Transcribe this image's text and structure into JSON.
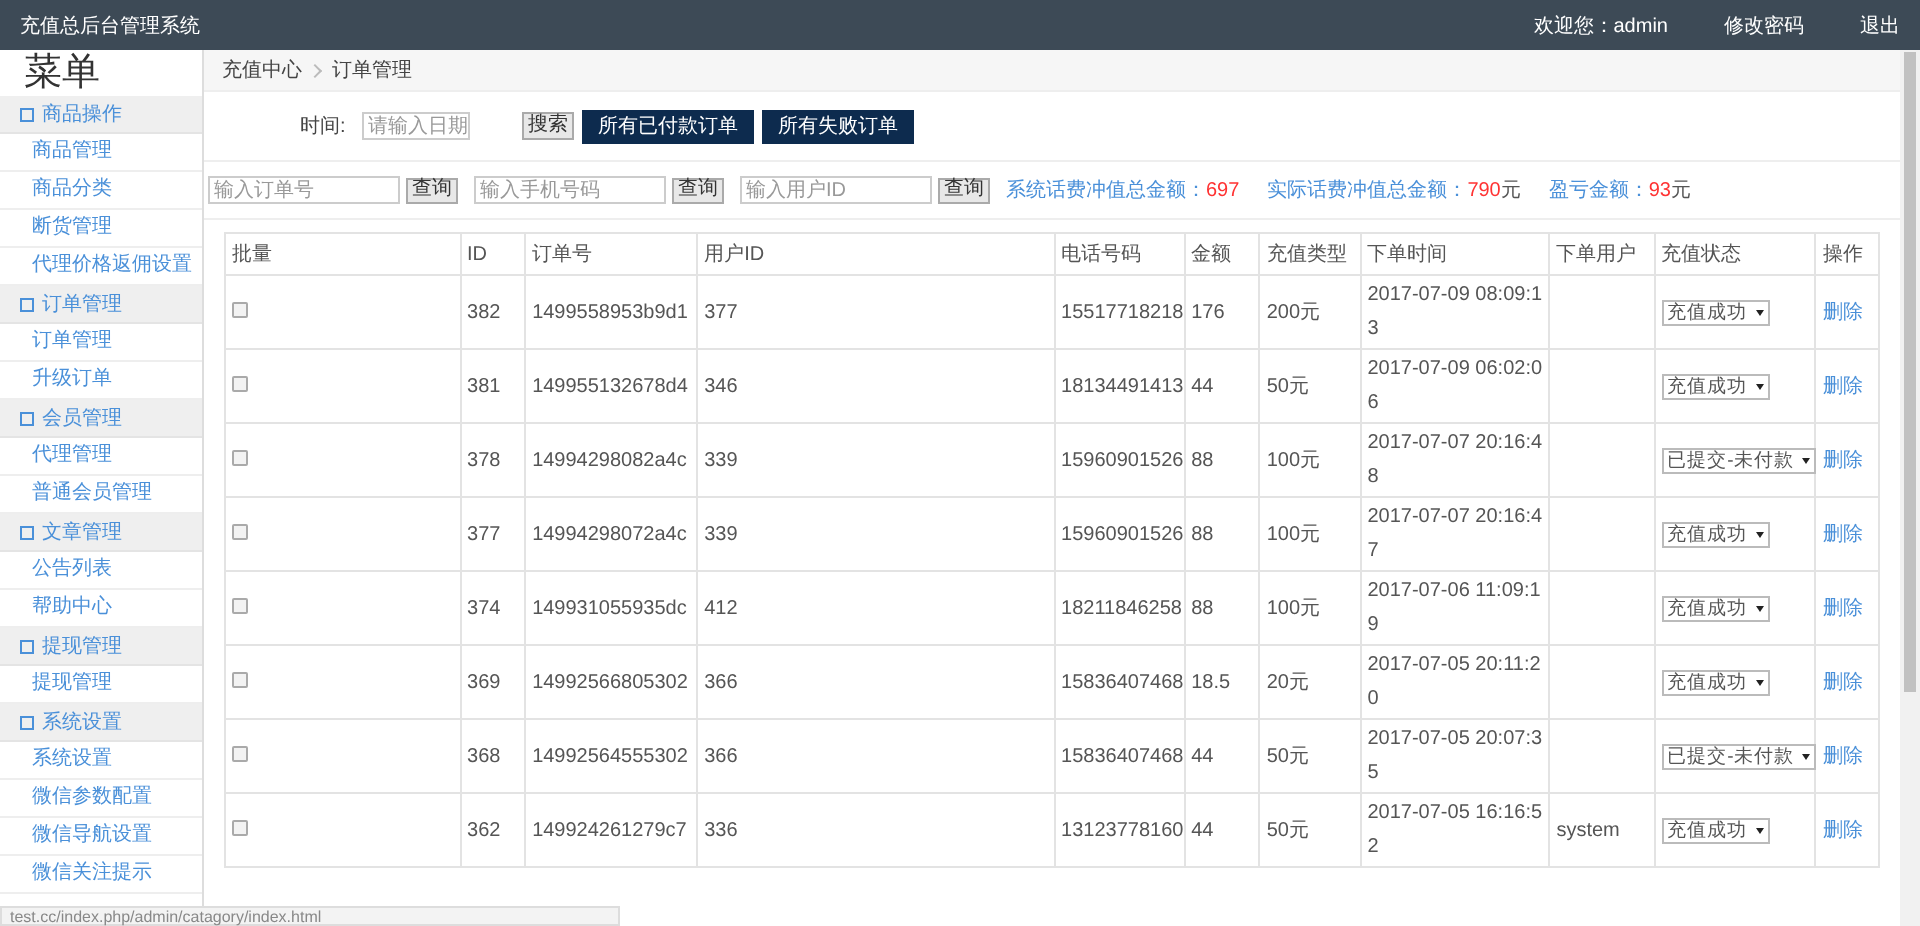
{
  "topbar": {
    "title": "充值总后台管理系统",
    "welcome": "欢迎您：admin",
    "links": [
      "修改密码",
      "退出"
    ]
  },
  "sidebar": {
    "heading": "菜单",
    "groups": [
      {
        "label": "商品操作",
        "items": [
          "商品管理",
          "商品分类",
          "断货管理",
          "代理价格返佣设置"
        ]
      },
      {
        "label": "订单管理",
        "items": [
          "订单管理",
          "升级订单"
        ]
      },
      {
        "label": "会员管理",
        "items": [
          "代理管理",
          "普通会员管理"
        ]
      },
      {
        "label": "文章管理",
        "items": [
          "公告列表",
          "帮助中心"
        ]
      },
      {
        "label": "提现管理",
        "items": [
          "提现管理"
        ]
      },
      {
        "label": "系统设置",
        "items": [
          "系统设置",
          "微信参数配置",
          "微信导航设置",
          "微信关注提示"
        ]
      }
    ]
  },
  "breadcrumb": [
    "充值中心",
    "订单管理"
  ],
  "date_filter": {
    "label": "时间:",
    "placeholder": "请输入日期",
    "button": "搜索"
  },
  "order_buttons": [
    "所有已付款订单",
    "所有失败订单"
  ],
  "queries": [
    {
      "placeholder": "输入订单号",
      "button": "查询"
    },
    {
      "placeholder": "输入手机号码",
      "button": "查询"
    },
    {
      "placeholder": "输入用户ID",
      "button": "查询"
    }
  ],
  "stats": [
    {
      "label": "系统话费冲值总金额：",
      "value": "697"
    },
    {
      "label": "实际话费冲值总金额：",
      "value": "790",
      "unit": "元"
    },
    {
      "label": "盈亏金额：",
      "value": "93",
      "unit": "元"
    }
  ],
  "table": {
    "columns": [
      "批量",
      "ID",
      "订单号",
      "用户ID",
      "电话号码",
      "金额",
      "充值类型",
      "下单时间",
      "下单用户",
      "充值状态",
      "操作"
    ],
    "rows": [
      {
        "checked": false,
        "id": "382",
        "order_no": "1499558953b9d1",
        "user_id": "377",
        "phone": "15517718218",
        "amount": "176",
        "type": "200元",
        "time": "2017-07-09 08:09:13",
        "status": "充值成功",
        "action": "删除"
      },
      {
        "checked": false,
        "id": "381",
        "order_no": "149955132678d4",
        "user_id": "346",
        "phone": "18134491413",
        "amount": "44",
        "type": "50元",
        "time": "2017-07-09 06:02:06",
        "status": "充值成功",
        "action": "删除"
      },
      {
        "checked": false,
        "id": "378",
        "order_no": "14994298082a4c",
        "user_id": "339",
        "phone": "15960901526",
        "amount": "88",
        "type": "100元",
        "time": "2017-07-07 20:16:48",
        "status": "已提交-未付款",
        "action": "删除"
      },
      {
        "checked": false,
        "id": "377",
        "order_no": "14994298072a4c",
        "user_id": "339",
        "phone": "15960901526",
        "amount": "88",
        "type": "100元",
        "time": "2017-07-07 20:16:47",
        "status": "充值成功",
        "action": "删除"
      },
      {
        "checked": false,
        "id": "374",
        "order_no": "149931055935dc",
        "user_id": "412",
        "phone": "18211846258",
        "amount": "88",
        "type": "100元",
        "time": "2017-07-06 11:09:19",
        "status": "充值成功",
        "action": "删除"
      },
      {
        "checked": false,
        "id": "369",
        "order_no": "14992566805302",
        "user_id": "366",
        "phone": "15836407468",
        "amount": "18.5",
        "type": "20元",
        "time": "2017-07-05 20:11:20",
        "status": "充值成功",
        "action": "删除"
      },
      {
        "checked": false,
        "id": "368",
        "order_no": "14992564555302",
        "user_id": "366",
        "phone": "15836407468",
        "amount": "44",
        "type": "50元",
        "time": "2017-07-05 20:07:35",
        "status": "已提交-未付款",
        "action": "删除"
      },
      {
        "checked": false,
        "id": "362",
        "order_no": "149924261279c7",
        "user_id": "336",
        "phone": "13123778160",
        "amount": "44",
        "type": "50元",
        "time": "2017-07-05 16:16:52",
        "user": "system",
        "status": "充值成功",
        "action": "删除"
      }
    ]
  },
  "status_bar": "test.cc/index.php/admin/catagory/index.html"
}
